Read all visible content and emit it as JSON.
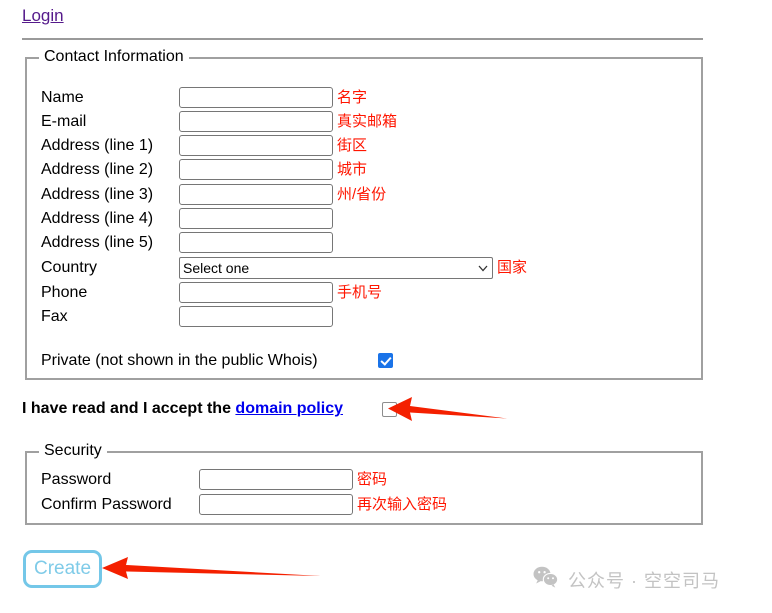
{
  "header": {
    "login_label": "Login"
  },
  "contact": {
    "legend": "Contact Information",
    "fields": [
      {
        "label": "Name",
        "value": "",
        "note": "名字"
      },
      {
        "label": "E-mail",
        "value": "",
        "note": "真实邮箱"
      },
      {
        "label": "Address (line 1)",
        "value": "",
        "note": "街区"
      },
      {
        "label": "Address (line 2)",
        "value": "",
        "note": "城市"
      },
      {
        "label": "Address (line 3)",
        "value": "",
        "note": "州/省份"
      },
      {
        "label": "Address (line 4)",
        "value": "",
        "note": ""
      },
      {
        "label": "Address (line 5)",
        "value": "",
        "note": ""
      }
    ],
    "country": {
      "label": "Country",
      "selected": "Select one",
      "options": [
        "Select one"
      ],
      "note": "国家",
      "chevron_icon": "chevron-down-icon"
    },
    "phone": {
      "label": "Phone",
      "value": "",
      "note": "手机号"
    },
    "fax": {
      "label": "Fax",
      "value": "",
      "note": ""
    },
    "private": {
      "label": "Private (not shown in the public Whois)",
      "checked": true
    }
  },
  "accept": {
    "text_before": "I have read and I accept the ",
    "link_label": "domain policy",
    "checked": false
  },
  "security": {
    "legend": "Security",
    "fields": [
      {
        "label": "Password",
        "value": "",
        "note": "密码"
      },
      {
        "label": "Confirm Password",
        "value": "",
        "note": "再次输入密码"
      }
    ]
  },
  "actions": {
    "create_label": "Create"
  },
  "annotations": {
    "arrow_color": "#f42000",
    "arrow_accept": "arrow-left-icon",
    "arrow_create": "arrow-left-icon"
  },
  "watermark": {
    "icon": "wechat-icon",
    "text": "公众号 · 空空司马",
    "color": "#c3c3c3"
  },
  "colors": {
    "link_visited": "#551a8b",
    "link_blue": "#0000ee",
    "note_red": "#ff1500",
    "checkbox_checked": "#1a73e8",
    "create_border": "#74c7e8",
    "create_text": "#7fcbe8"
  }
}
